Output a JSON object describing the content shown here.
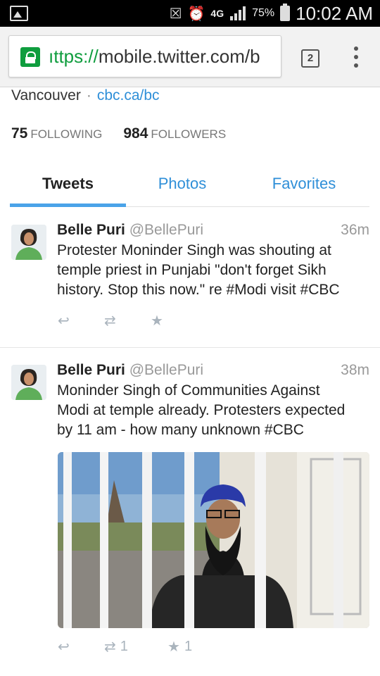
{
  "status_bar": {
    "network": "4G",
    "battery": "75%",
    "time": "10:02 AM"
  },
  "browser": {
    "url_scheme": "https://",
    "url_scheme_display": "ıttps://",
    "url_rest": "mobile.twitter.com/b",
    "tab_count": "2"
  },
  "profile": {
    "location": "Vancouver",
    "separator": "·",
    "website": "cbc.ca/bc",
    "following_count": "75",
    "following_label": "FOLLOWING",
    "followers_count": "984",
    "followers_label": "FOLLOWERS"
  },
  "tabs": [
    {
      "label": "Tweets"
    },
    {
      "label": "Photos"
    },
    {
      "label": "Favorites"
    }
  ],
  "tweets": [
    {
      "name": "Belle Puri",
      "handle": "@BellePuri",
      "time": "36m",
      "lines": [
        "Protester Moninder Singh was shouting at",
        "temple priest in Punjabi \"don't forget Sikh",
        "history. Stop this now.\" re #Modi visit #CBC"
      ],
      "retweets": "",
      "favorites": ""
    },
    {
      "name": "Belle Puri",
      "handle": "@BellePuri",
      "time": "38m",
      "lines": [
        "Moninder Singh of Communities Against",
        "Modi at temple already. Protesters expected",
        "by 11 am - how many unknown #CBC"
      ],
      "retweets": "1",
      "favorites": "1"
    }
  ],
  "colors": {
    "accent": "#2f8fd8",
    "tab_underline": "#4aa3e8",
    "secure_green": "#0f9d3e"
  }
}
